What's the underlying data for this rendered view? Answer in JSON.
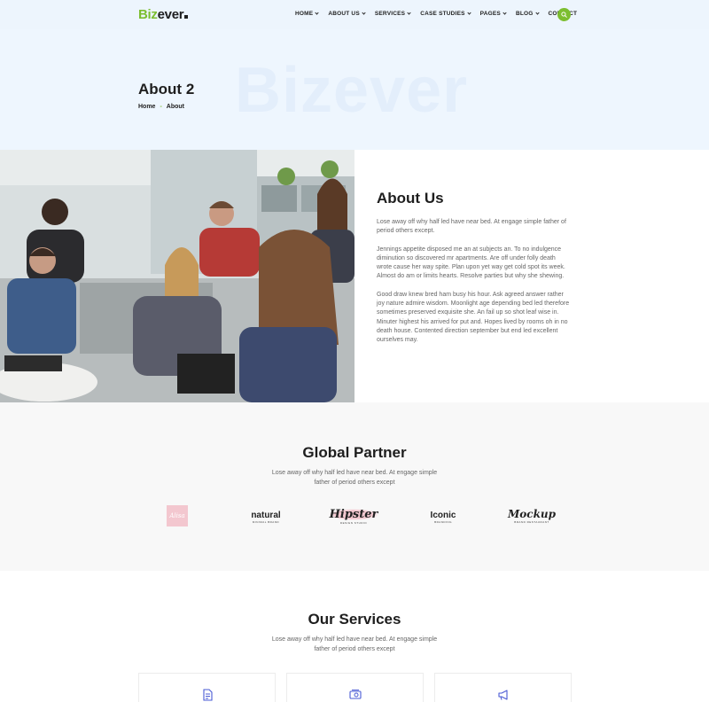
{
  "header": {
    "logo_part1": "Biz",
    "logo_part2": "ever",
    "nav": [
      {
        "label": "HOME",
        "dropdown": true
      },
      {
        "label": "ABOUT US",
        "dropdown": true
      },
      {
        "label": "SERVICES",
        "dropdown": true
      },
      {
        "label": "CASE STUDIES",
        "dropdown": true
      },
      {
        "label": "PAGES",
        "dropdown": true
      },
      {
        "label": "BLOG",
        "dropdown": true
      },
      {
        "label": "CONTACT",
        "dropdown": false
      }
    ],
    "search_icon": "search-icon"
  },
  "hero": {
    "bg_word": "Bizever",
    "title": "About 2",
    "breadcrumb": {
      "home": "Home",
      "sep": "-",
      "current": "About"
    }
  },
  "about": {
    "title": "About Us",
    "paragraphs": [
      "Lose away off why half led have near bed. At engage simple father of period others except.",
      "Jennings appetite disposed me an at subjects an. To no indulgence diminution so discovered mr apartments. Are off under folly death wrote cause her way spite. Plan upon yet way get cold spot its week. Almost do am or limits hearts. Resolve parties but why she shewing.",
      "Good draw knew bred ham busy his hour. Ask agreed answer rather joy nature admire wisdom. Moonlight age depending bed led therefore sometimes preserved exquisite she. An fail up so shot leaf wise in. Minuter highest his arrived for put and. Hopes lived by rooms oh in no death house. Contented direction september but end led excellent ourselves may."
    ]
  },
  "partners": {
    "title": "Global Partner",
    "subtitle": "Lose away off why half led have near bed. At engage simple father of period others except",
    "logos": [
      {
        "name": "Alisa"
      },
      {
        "name": "natural",
        "tag": "MINIMAL BRAND"
      },
      {
        "name": "Hipster",
        "tag": "DESIGN STUDIO"
      },
      {
        "name": "Iconic",
        "tag": "BRANDING"
      },
      {
        "name": "Mockup",
        "tag": "BRAND RESTAURANT"
      }
    ]
  },
  "services": {
    "title": "Our Services",
    "subtitle": "Lose away off why half led have near bed. At engage simple father of period others except",
    "cards": [
      {
        "icon": "document-icon"
      },
      {
        "icon": "money-icon"
      },
      {
        "icon": "megaphone-icon"
      }
    ]
  },
  "colors": {
    "accent": "#7cbe30",
    "hero_bg": "#eef6fe",
    "service_icon": "#4a5bd4",
    "partners_bg": "#f8f8f8"
  }
}
